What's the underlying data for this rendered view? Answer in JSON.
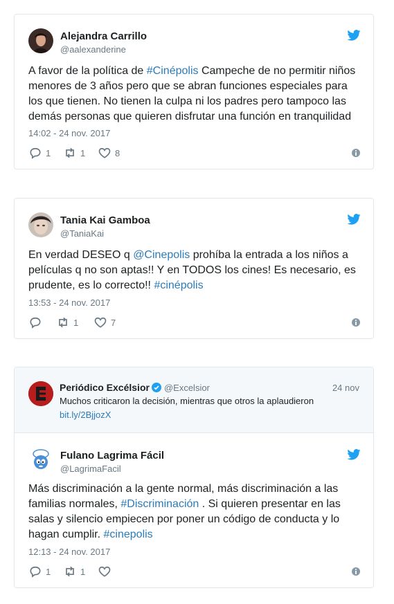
{
  "tweets": [
    {
      "name": "Alejandra Carrillo",
      "handle": "@aalexanderine",
      "text_parts": [
        "A favor de la política de ",
        "#Cinépolis",
        " Campeche de no permitir niños menores de 3 años pero que se abran funciones especiales para los que tienen. No tienen la culpa ni los padres pero tampoco las demás personas que quieren disfrutar una función en tranquilidad"
      ],
      "time": "14:02 - 24 nov. 2017",
      "replies": "1",
      "retweets": "1",
      "likes": "8"
    },
    {
      "name": "Tania Kai Gamboa",
      "handle": "@TaniaKai",
      "text_parts": [
        "En verdad DESEO q ",
        "@Cinepolis",
        " prohíba la entrada a los niños a películas q no son aptas!! Y en TODOS los cines! Es necesario, es prudente, es lo correcto!! ",
        "#cinépolis"
      ],
      "time": "13:53 - 24 nov. 2017",
      "replies": "",
      "retweets": "1",
      "likes": "7"
    },
    {
      "quoted": {
        "name": "Periódico Excélsior",
        "handle": "@Excelsior",
        "date": "24 nov",
        "text": "Muchos criticaron la decisión, mientras que otros la aplaudieron",
        "link": "bit.ly/2BjjozX"
      },
      "name": "Fulano Lagrima Fácil",
      "handle": "@LagrimaFacil",
      "text_parts": [
        "Más discriminación a la gente normal, más discriminación a las familias normales, ",
        "#Discriminación",
        " . Si quieren presentar en las salas y silencio empiecen por poner un código de conducta y lo hagan cumplir. ",
        "#cinepolis"
      ],
      "time": "12:13 - 24 nov. 2017",
      "replies": "1",
      "retweets": "1",
      "likes": ""
    }
  ],
  "icons": {
    "bird": "twitter-bird-icon",
    "reply": "reply-icon",
    "retweet": "retweet-icon",
    "like": "heart-icon",
    "info": "info-icon",
    "verified": "verified-badge-icon"
  },
  "colors": {
    "accent": "#1da1f2",
    "link": "#2b7bb9",
    "muted": "#697882",
    "border": "#e1e8ed"
  }
}
